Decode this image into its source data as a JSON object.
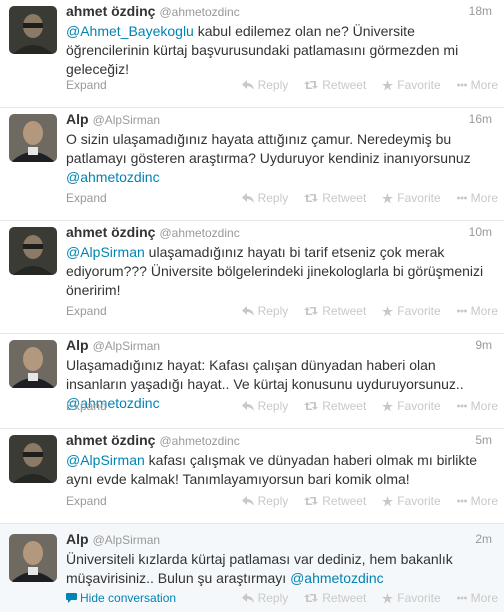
{
  "tweets": [
    {
      "name": "ahmet özdinç",
      "handle": "@ahmetozdinc",
      "time": "18m",
      "parts": [
        {
          "t": "@Ahmet_Bayekoglu",
          "m": true
        },
        {
          "t": " kabul edilemez olan ne? Üniversite öğrencilerinin kürtaj başvurusundaki patlamasını görmezden mi geleceğiz!",
          "m": false
        }
      ],
      "footer": "Expand"
    },
    {
      "name": "Alp",
      "handle": "@AlpSirman",
      "time": "16m",
      "parts": [
        {
          "t": "O sizin ulaşamadığınız hayata attığınız çamur. Neredeymiş bu patlamayı gösteren araştırma? Uyduruyor kendiniz inanıyorsunuz ",
          "m": false
        },
        {
          "t": "@ahmetozdinc",
          "m": true
        }
      ],
      "footer": "Expand"
    },
    {
      "name": "ahmet özdinç",
      "handle": "@ahmetozdinc",
      "time": "10m",
      "parts": [
        {
          "t": "@AlpSirman",
          "m": true
        },
        {
          "t": " ulaşamadığınız hayatı bi tarif etseniz çok merak ediyorum??? Üniversite bölgelerindeki jinekologlarla bi görüşmenizi öneririm!",
          "m": false
        }
      ],
      "footer": "Expand"
    },
    {
      "name": "Alp",
      "handle": "@AlpSirman",
      "time": "9m",
      "parts": [
        {
          "t": "Ulaşamadığınız hayat: Kafası çalışan dünyadan haberi olan insanların yaşadığı hayat.. Ve kürtaj konusunu uyduruyorsunuz.. ",
          "m": false
        },
        {
          "t": "@ahmetozdinc",
          "m": true
        }
      ],
      "footer": "Expand"
    },
    {
      "name": "ahmet özdinç",
      "handle": "@ahmetozdinc",
      "time": "5m",
      "parts": [
        {
          "t": "@AlpSirman",
          "m": true
        },
        {
          "t": " kafası çalışmak ve dünyadan haberi olmak mı birlikte aynı evde kalmak! Tanımlayamıyorsun bari komik olma!",
          "m": false
        }
      ],
      "footer": "Expand"
    },
    {
      "name": "Alp",
      "handle": "@AlpSirman",
      "time": "2m",
      "parts": [
        {
          "t": "Üniversiteli kızlarda kürtaj patlaması var dediniz, hem bakanlık müşavirisiniz.. Bulun şu araştırmayı ",
          "m": false
        },
        {
          "t": "@ahmetozdinc",
          "m": true
        }
      ],
      "footer": "Hide conversation"
    }
  ],
  "actions": {
    "reply": "Reply",
    "retweet": "Retweet",
    "favorite": "Favorite",
    "more": "More"
  },
  "colors": {
    "link": "#0084b4",
    "muted": "#999999",
    "action": "#c8c8c8"
  },
  "icons": {
    "reply": "reply-icon",
    "retweet": "retweet-icon",
    "favorite": "star-icon",
    "more": "more-icon",
    "hide": "speech-bubble-icon"
  }
}
